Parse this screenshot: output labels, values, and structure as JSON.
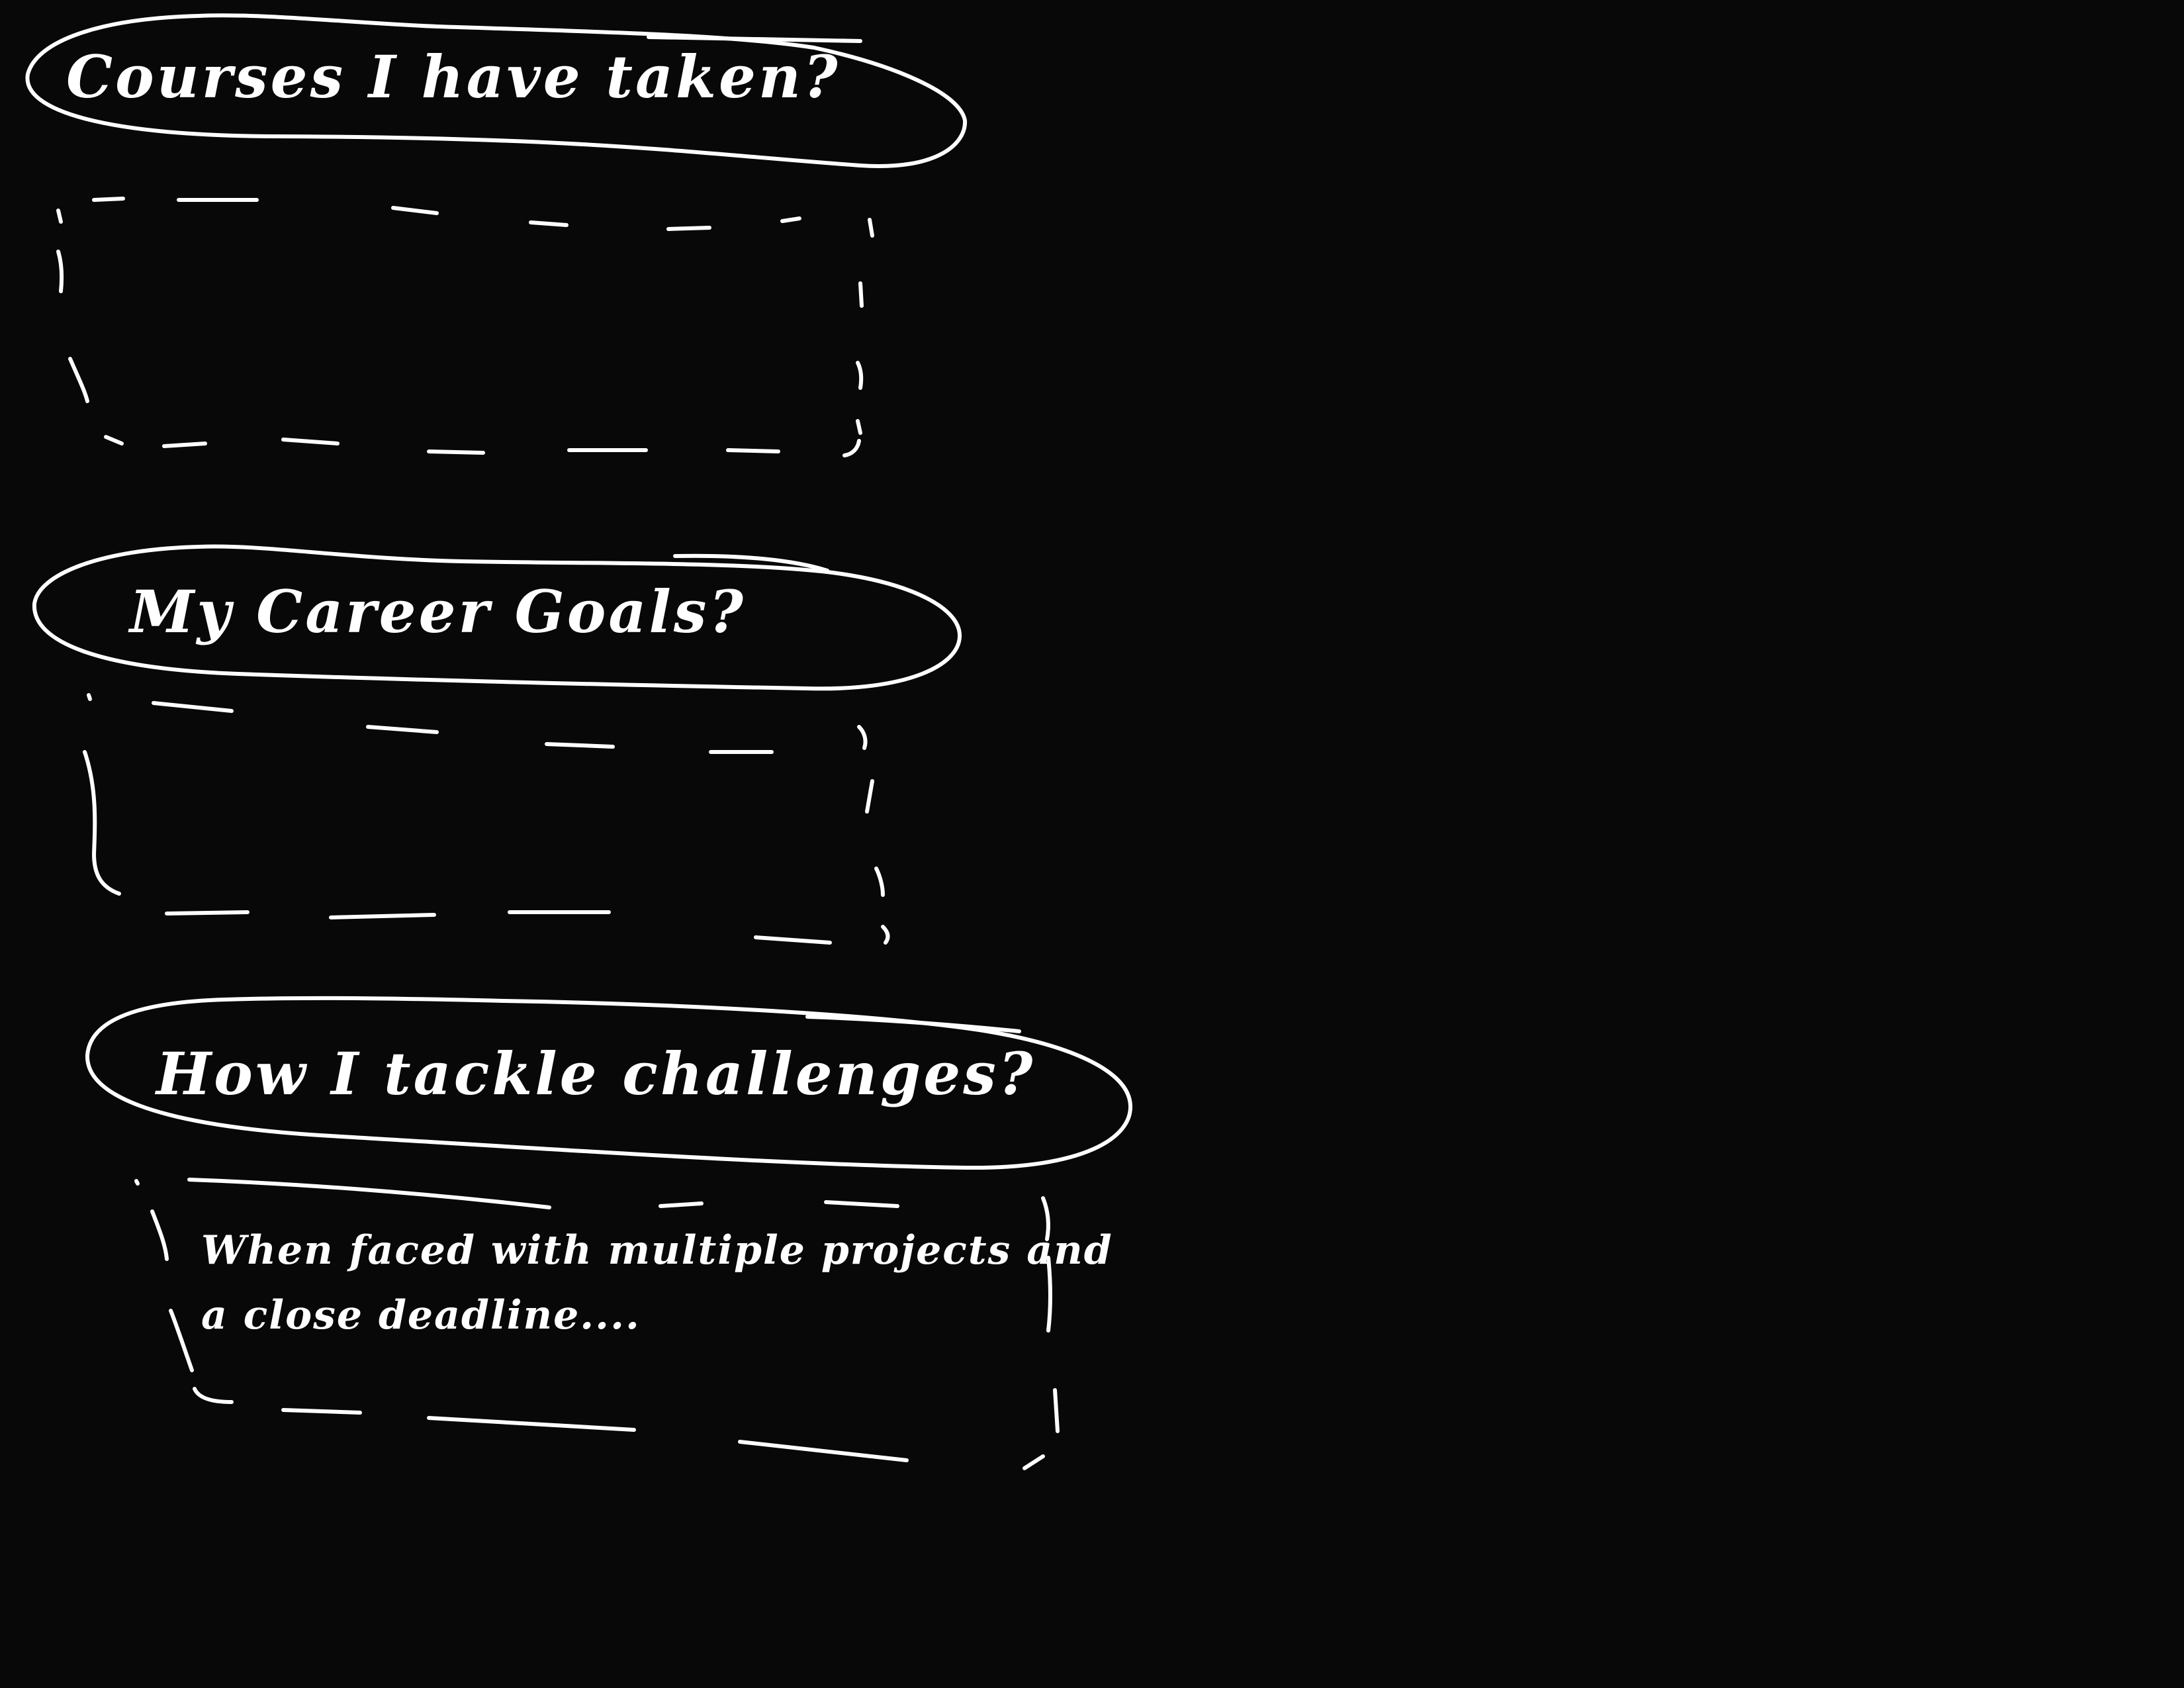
{
  "canvas": {
    "background_color": "#080808",
    "ink_color": "#ffffff"
  },
  "sections": [
    {
      "question": "Courses I have taken?",
      "answer": ""
    },
    {
      "question": "My Career Goals?",
      "answer": ""
    },
    {
      "question": "How I tackle challenges?",
      "answer": "When faced with multiple projects and\na close deadline...."
    }
  ]
}
